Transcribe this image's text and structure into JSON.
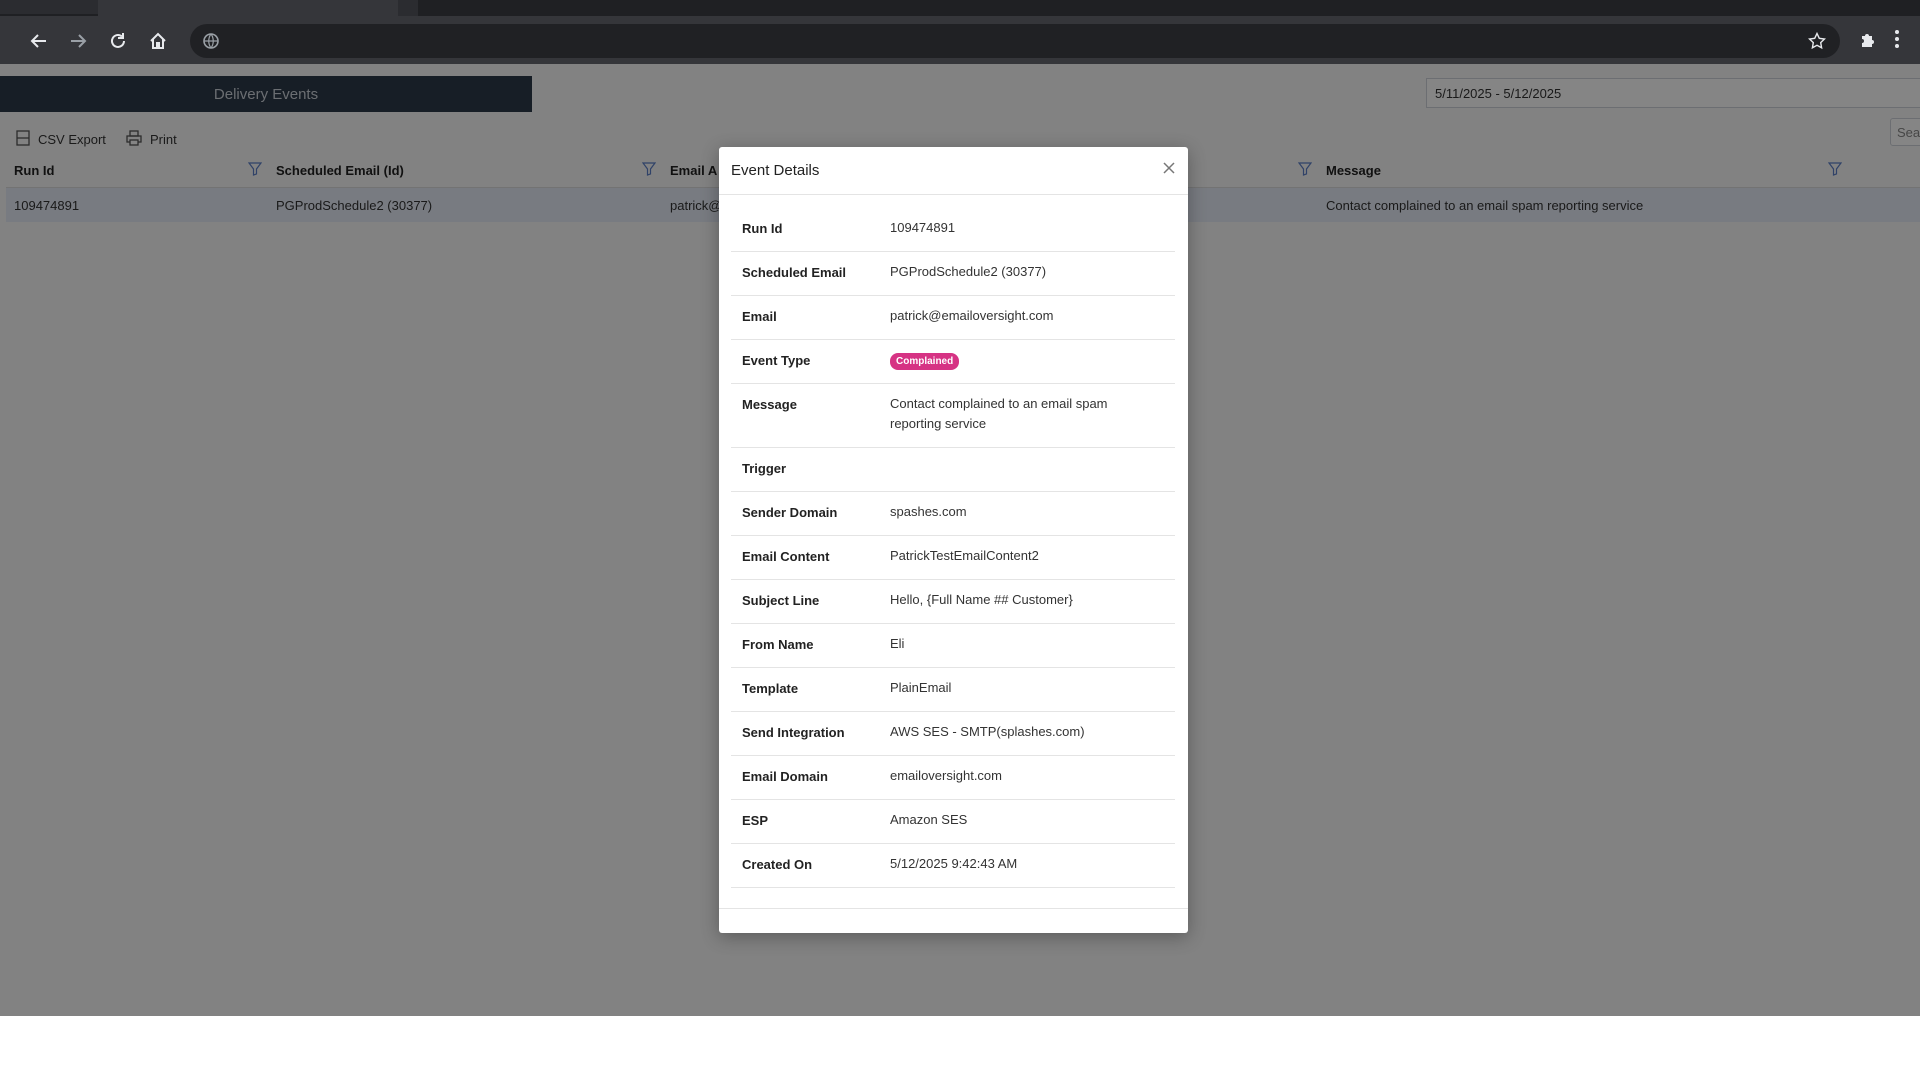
{
  "browser": {
    "toolbar_icons": [
      "back-icon",
      "forward-icon",
      "reload-icon",
      "home-icon",
      "site-info-icon",
      "bookmark-star-icon",
      "extensions-icon",
      "menu-icon"
    ],
    "colors": {
      "tabstrip": "#1f2023",
      "toolbar": "#35363a",
      "omnibox": "#202124"
    }
  },
  "page": {
    "section_tab": "Delivery Events",
    "date_range": "5/11/2025 - 5/12/2025",
    "toolbar": {
      "csv_export": "CSV Export",
      "print": "Print",
      "search_placeholder": "Sea"
    },
    "grid": {
      "columns": [
        "Run Id",
        "Scheduled Email (Id)",
        "Email A",
        "Message"
      ],
      "rows": [
        {
          "run_id": "109474891",
          "scheduled_email": "PGProdSchedule2 (30377)",
          "email": "patrick@",
          "message": "Contact complained to an email spam reporting service"
        }
      ]
    }
  },
  "modal": {
    "title": "Event Details",
    "details": [
      {
        "label": "Run Id",
        "value": "109474891"
      },
      {
        "label": "Scheduled Email",
        "value": "PGProdSchedule2 (30377)"
      },
      {
        "label": "Email",
        "value": "patrick@emailoversight.com"
      },
      {
        "label": "Event Type",
        "value": "Complained",
        "badge_color": "#d63384"
      },
      {
        "label": "Message",
        "value": "Contact complained to an email spam reporting service"
      },
      {
        "label": "Trigger",
        "value": ""
      },
      {
        "label": "Sender Domain",
        "value": "spashes.com"
      },
      {
        "label": "Email Content",
        "value": "PatrickTestEmailContent2"
      },
      {
        "label": "Subject Line",
        "value": "Hello, {Full Name ## Customer}"
      },
      {
        "label": "From Name",
        "value": "Eli"
      },
      {
        "label": "Template",
        "value": "PlainEmail"
      },
      {
        "label": "Send Integration",
        "value": "AWS SES - SMTP(splashes.com)"
      },
      {
        "label": "Email Domain",
        "value": "emailoversight.com"
      },
      {
        "label": "ESP",
        "value": "Amazon SES"
      },
      {
        "label": "Created On",
        "value": "5/12/2025 9:42:43 AM"
      }
    ]
  }
}
